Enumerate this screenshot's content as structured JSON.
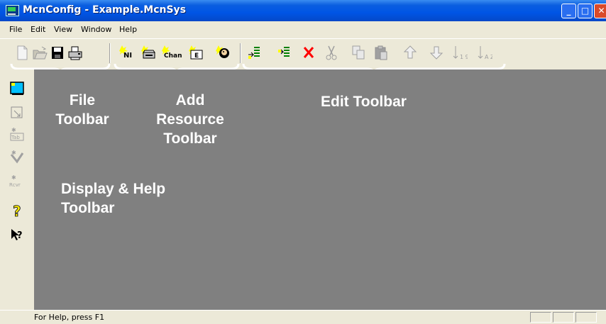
{
  "window": {
    "title": "McnConfig - Example.McnSys",
    "minimize_glyph": "_",
    "maximize_glyph": "□",
    "close_glyph": "✕"
  },
  "menu": [
    "File",
    "Edit",
    "View",
    "Window",
    "Help"
  ],
  "toolbar": {
    "file": [
      "new-icon",
      "open-icon",
      "save-icon",
      "print-icon"
    ],
    "add_resource": [
      {
        "icon": "add-ni-icon",
        "label": "NI"
      },
      {
        "icon": "add-device-icon",
        "label": ""
      },
      {
        "icon": "add-channel-icon",
        "label": "Chan"
      },
      {
        "icon": "add-e-icon",
        "label": "E"
      },
      {
        "icon": "add-person-icon",
        "label": ""
      }
    ],
    "edit": [
      "insert-before-icon",
      "insert-after-icon",
      "delete-icon",
      "cut-icon",
      "copy-icon",
      "paste-icon",
      "move-up-icon",
      "move-down-icon",
      "sort-numeric-icon",
      "sort-alpha-icon"
    ],
    "sort_numeric_glyph": "1 9",
    "sort_alpha_glyph": "A Z"
  },
  "sidebar": {
    "buttons": [
      "display-icon",
      "window-icon",
      "tab-icon",
      "wizard-icon",
      "receiver-icon",
      "help-icon",
      "context-help-icon"
    ],
    "tab_label": "Tab",
    "rcvr_label": "Rcvr",
    "help_glyph": "?",
    "context_help_glyph": "?"
  },
  "annotations": {
    "file_toolbar": [
      "File",
      "Toolbar"
    ],
    "add_resource_toolbar": [
      "Add",
      "Resource",
      "Toolbar"
    ],
    "edit_toolbar": "Edit Toolbar",
    "display_help_toolbar": [
      "Display & Help",
      "Toolbar"
    ]
  },
  "status": {
    "text": "For Help, press F1"
  },
  "colors": {
    "titlebar": "#0055e5",
    "client_area": "#808080",
    "chrome": "#ece9d8",
    "annotation": "#ffffff"
  }
}
